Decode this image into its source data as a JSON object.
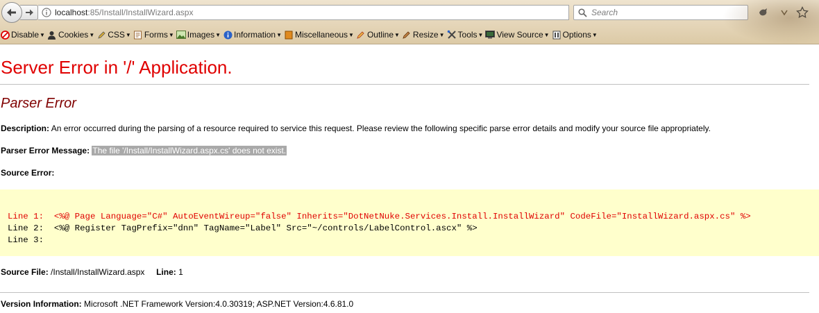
{
  "browser": {
    "url_host": "localhost",
    "url_rest": ":85/Install/InstallWizard.aspx",
    "search_placeholder": "Search"
  },
  "toolbar": {
    "items": [
      {
        "label": "Disable",
        "icon": "no-entry-icon"
      },
      {
        "label": "Cookies",
        "icon": "person-icon"
      },
      {
        "label": "CSS",
        "icon": "pencil-icon"
      },
      {
        "label": "Forms",
        "icon": "form-icon"
      },
      {
        "label": "Images",
        "icon": "image-icon"
      },
      {
        "label": "Information",
        "icon": "info-icon"
      },
      {
        "label": "Miscellaneous",
        "icon": "box-icon"
      },
      {
        "label": "Outline",
        "icon": "outline-pencil-icon"
      },
      {
        "label": "Resize",
        "icon": "resize-icon"
      },
      {
        "label": "Tools",
        "icon": "tools-icon"
      },
      {
        "label": "View Source",
        "icon": "monitor-icon"
      },
      {
        "label": "Options",
        "icon": "options-icon"
      }
    ]
  },
  "page": {
    "title": "Server Error in '/' Application.",
    "subtitle": "Parser Error",
    "description_label": "Description:",
    "description_text": "An error occurred during the parsing of a resource required to service this request. Please review the following specific parse error details and modify your source file appropriately.",
    "parser_msg_label": "Parser Error Message:",
    "parser_msg_text": "The file '/Install/InstallWizard.aspx.cs' does not exist.",
    "source_error_label": "Source Error:",
    "code_lines": [
      "Line 1:  <%@ Page Language=\"C#\" AutoEventWireup=\"false\" Inherits=\"DotNetNuke.Services.Install.InstallWizard\" CodeFile=\"InstallWizard.aspx.cs\" %>",
      "Line 2:  <%@ Register TagPrefix=\"dnn\" TagName=\"Label\" Src=\"~/controls/LabelControl.ascx\" %>",
      "Line 3:"
    ],
    "source_file_label": "Source File:",
    "source_file_value": "/Install/InstallWizard.aspx",
    "line_label": "Line:",
    "line_value": "1",
    "version_label": "Version Information:",
    "version_text": "Microsoft .NET Framework Version:4.0.30319; ASP.NET Version:4.6.81.0"
  },
  "colors": {
    "error_red": "#e00000",
    "subtitle_maroon": "#800000",
    "code_bg": "#ffffcc"
  }
}
